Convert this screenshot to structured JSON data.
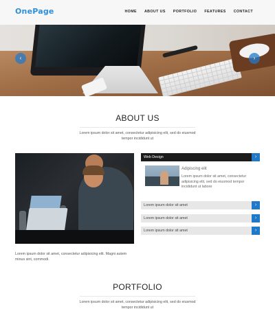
{
  "header": {
    "logo": "OnePage",
    "nav": [
      "HOME",
      "ABOUT US",
      "PORTFOLIO",
      "FEATURES",
      "CONTACT"
    ]
  },
  "hero": {
    "prev_arrow": "‹",
    "next_arrow": "›"
  },
  "about": {
    "title": "ABOUT US",
    "lead": "Lorem ipsum dolor sit amet, consectetur adipisicing elit, sed do eiusmod tempor incididunt ut",
    "caption": "Lorem ipsum dolor sit amet, consectetur adipisicing elit. Magni autem minus sint, commodi.",
    "accordion": {
      "items": [
        {
          "label": "Web Design",
          "button": "›"
        },
        {
          "label": "Lorem ipsum dolor sit amet",
          "button": "›"
        },
        {
          "label": "Lorem ipsum dolor sit amet",
          "button": "›"
        },
        {
          "label": "Lorem ipsum dolor sit amet",
          "button": "›"
        }
      ],
      "panel": {
        "title": "Adipiscing elit",
        "text": "Lorem ipsum dolor sit amet, consectetur adipisicing elit, sed do eiusmod tempor incididunt ut labore"
      }
    }
  },
  "portfolio": {
    "title": "PORTFOLIO",
    "lead": "Lorem ipsum dolor sit amet, consectetur adipisicing elit, sed do eiusmod tempor incididunt ut"
  },
  "colors": {
    "accent": "#2e8fd8",
    "button_blue": "#1f79c9",
    "dark_tab": "#1b1b1b"
  }
}
